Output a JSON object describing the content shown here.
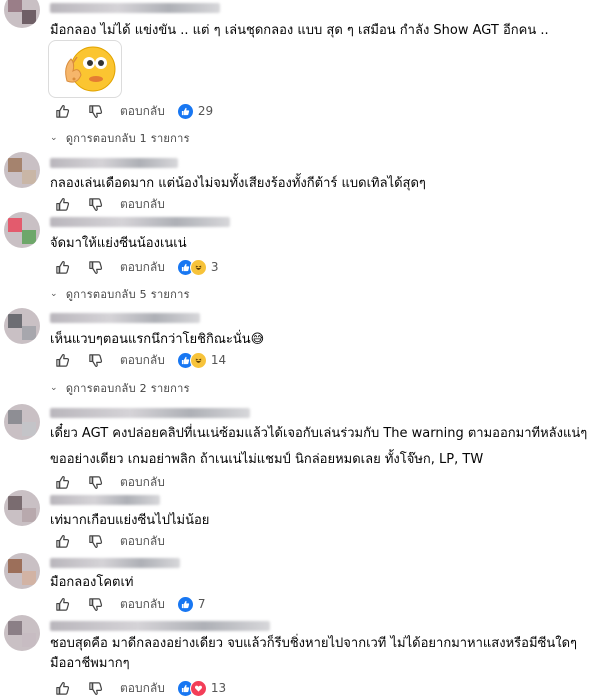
{
  "comments": [
    {
      "text": "มือกลอง ไม่ได้ แข่งขัน .. แต่ ๆ เล่นชุดกลอง แบบ สุด ๆ เสมือน กำลัง Show AGT อีกคน ..",
      "count": "29",
      "replies_label": "ดูการตอบกลับ 1 รายการ"
    },
    {
      "text": "กลองเล่นเดือดมาก แต่น้องไม่จมทั้งเสียงร้องทั้งกีต้าร์ แบดเทิลได้สุดๆ",
      "count": "",
      "replies_label": ""
    },
    {
      "text": "จัดมาให้แย่งซีนน้องเนเน่",
      "count": "3",
      "replies_label": "ดูการตอบกลับ 5 รายการ"
    },
    {
      "text": "เห็นแวบๆตอนแรกนึกว่าโยชิกิณะนั่น😅",
      "count": "14",
      "replies_label": "ดูการตอบกลับ 2 รายการ"
    },
    {
      "text": "เดี๋ยว AGT คงปล่อยคลิปที่เนเน่ซ้อมแล้วได้เจอกับเล่นร่วมกับ The warning ตามออกมาทีหลังแน่ๆ",
      "text2": "ขออย่างเดียว เกมอย่าพลิก ถ้าเนเน่ไม่แชมป์ นิกล่อยหมดเลย ทั้งโจ๊ษก, LP, TW",
      "count": "",
      "replies_label": ""
    },
    {
      "text": "เท่มากเกือบแย่งซีนไปไม่น้อย",
      "count": "",
      "replies_label": ""
    },
    {
      "text": "มือกลองโคตเท่",
      "count": "7",
      "replies_label": ""
    },
    {
      "text": "ชอบสุดคือ มาดีกลองอย่างเดียว จบแล้วก็รีบชิ่งหายไปจากเวที ไม่ได้อยากมาหาแสงหรือมีซีนใดๆ",
      "text2": "มืออาชีพมากๆ",
      "count": "13",
      "replies_label": ""
    }
  ],
  "ui": {
    "reply_label": "ตอบกลับ"
  },
  "icons": {
    "like": "thumbs-up-icon",
    "dislike": "thumbs-down-icon",
    "chevron": "chevron-down-icon",
    "reaction_like": "like-reaction-icon",
    "reaction_haha": "haha-reaction-icon",
    "reaction_love": "love-reaction-icon",
    "sticker": "face-hiding-sticker"
  },
  "colors": {
    "like_blue": "#1877f2",
    "haha_yellow": "#f7c33a",
    "love_red": "#f33e58",
    "muted_text": "#555555"
  }
}
